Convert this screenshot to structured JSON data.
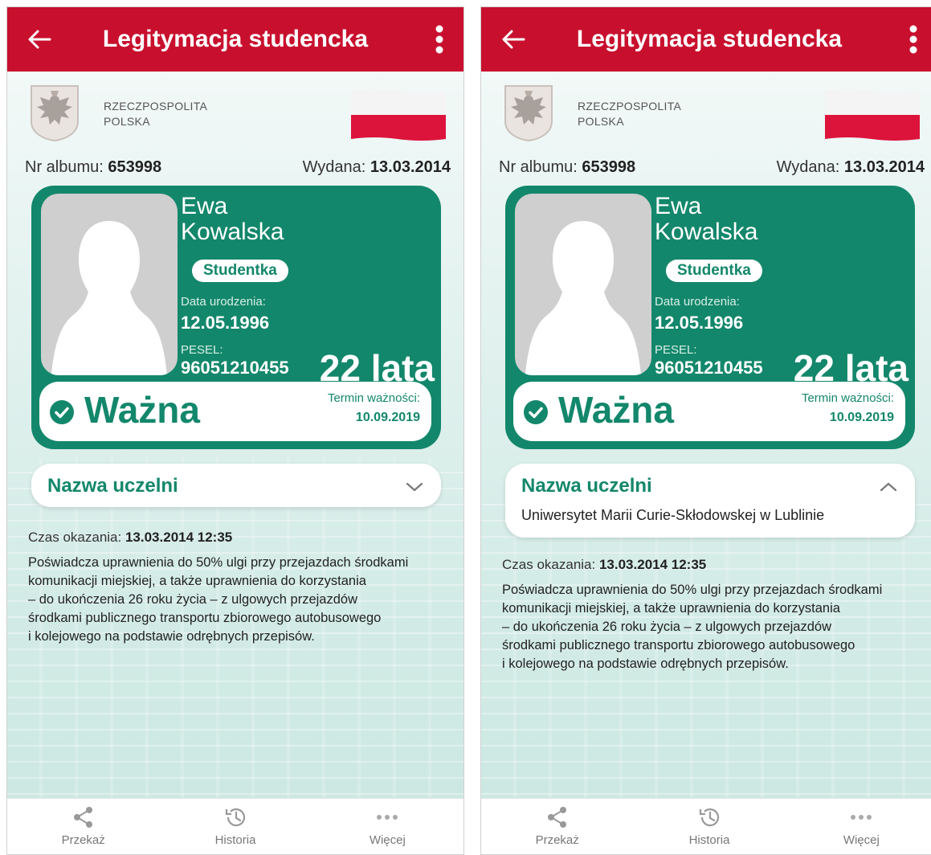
{
  "screens": [
    {
      "id": "collapsed",
      "app_bar": {
        "title": "Legitymacja studencka"
      },
      "header": {
        "country_line1": "RZECZPOSPOLITA",
        "country_line2": "POLSKA"
      },
      "album": {
        "label": "Nr albumu:",
        "value": "653998"
      },
      "issued": {
        "label": "Wydana:",
        "value": "13.03.2014"
      },
      "card": {
        "first_name": "Ewa",
        "last_name": "Kowalska",
        "role": "Studentka",
        "dob_label": "Data urodzenia:",
        "dob_value": "12.05.1996",
        "pesel_label": "PESEL:",
        "pesel_value": "96051210455",
        "age": "22 lata",
        "status": "Ważna",
        "valid_label": "Termin ważności:",
        "valid_date": "10.09.2019"
      },
      "university": {
        "title": "Nazwa uczelni",
        "expanded": false,
        "name": ""
      },
      "show_time": {
        "label": "Czas okazania:",
        "value": "13.03.2014 12:35"
      },
      "description": [
        "Poświadcza uprawnienia do 50% ulgi przy przejazdach środkami",
        "komunikacji miejskiej, a także uprawnienia do korzystania",
        "– do ukończenia 26 roku życia – z ulgowych przejazdów",
        "środkami publicznego transportu zbiorowego autobusowego",
        "i kolejowego na podstawie odrębnych przepisów."
      ],
      "nav": {
        "share": "Przekaż",
        "history": "Historia",
        "more": "Więcej"
      }
    },
    {
      "id": "expanded",
      "app_bar": {
        "title": "Legitymacja studencka"
      },
      "header": {
        "country_line1": "RZECZPOSPOLITA",
        "country_line2": "POLSKA"
      },
      "album": {
        "label": "Nr albumu:",
        "value": "653998"
      },
      "issued": {
        "label": "Wydana:",
        "value": "13.03.2014"
      },
      "card": {
        "first_name": "Ewa",
        "last_name": "Kowalska",
        "role": "Studentka",
        "dob_label": "Data urodzenia:",
        "dob_value": "12.05.1996",
        "pesel_label": "PESEL:",
        "pesel_value": "96051210455",
        "age": "22 lata",
        "status": "Ważna",
        "valid_label": "Termin ważności:",
        "valid_date": "10.09.2019"
      },
      "university": {
        "title": "Nazwa uczelni",
        "expanded": true,
        "name": "Uniwersytet Marii Curie-Skłodowskej w Lublinie"
      },
      "show_time": {
        "label": "Czas okazania:",
        "value": "13.03.2014 12:35"
      },
      "description": [
        "Poświadcza uprawnienia do 50% ulgi przy przejazdach środkami",
        "komunikacji miejskiej, a także uprawnienia do korzystania",
        "– do ukończenia 26 roku życia – z ulgowych przejazdów",
        "środkami publicznego transportu zbiorowego autobusowego",
        "i kolejowego na podstawie odrębnych przepisów."
      ],
      "nav": {
        "share": "Przekaż",
        "history": "Historia",
        "more": "Więcej"
      }
    }
  ],
  "colors": {
    "primary_red": "#c8102e",
    "primary_green": "#13876b"
  },
  "icons": {
    "back": "arrow-left-icon",
    "menu": "kebab-menu-icon",
    "check": "check-circle-icon",
    "share": "share-icon",
    "history": "history-icon",
    "more": "more-dots-icon"
  }
}
